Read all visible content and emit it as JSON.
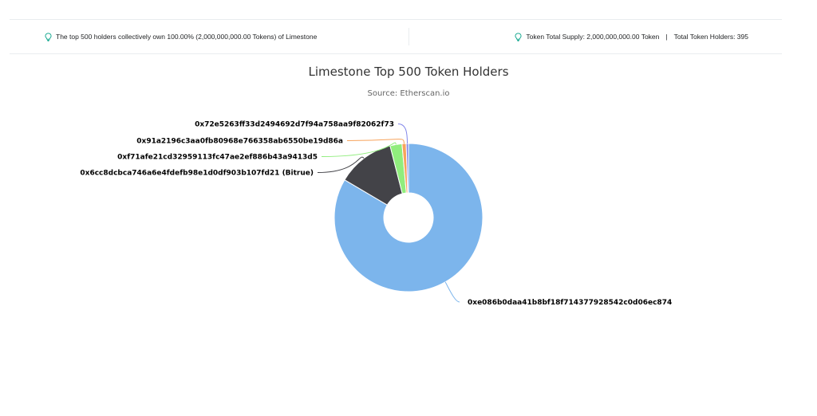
{
  "info_bar": {
    "left_text": "The top 500 holders collectively own 100.00% (2,000,000,000.00 Tokens) of Limestone",
    "supply_text": "Token Total Supply: 2,000,000,000.00 Token",
    "separator": "|",
    "holders_text": "Total Token Holders: 395",
    "icon": "lightbulb-icon"
  },
  "chart_data": {
    "type": "pie",
    "title": "Limestone Top 500 Token Holders",
    "subtitle": "Source: Etherscan.io",
    "donut": true,
    "series": [
      {
        "label": "0xe086b0daa41b8bf18f714377928542c0d06ec874",
        "percent": 83.5,
        "color": "#7cb5ec"
      },
      {
        "label": "0x6cc8dcbca746a6e4fdefb98e1d0df903b107fd21 (Bitrue)",
        "percent": 12.5,
        "color": "#434348"
      },
      {
        "label": "0xf71afe21cd32959113fc47ae2ef886b43a9413d5",
        "percent": 2.6,
        "color": "#90ed7d"
      },
      {
        "label": "0x91a2196c3aa0fb80968e766358ab6550be19d86a",
        "percent": 0.9,
        "color": "#f7a35c"
      },
      {
        "label": "0x72e5263ff33d2494692d7f94a758aa9f82062f73",
        "percent": 0.5,
        "color": "#8085e9"
      }
    ]
  }
}
